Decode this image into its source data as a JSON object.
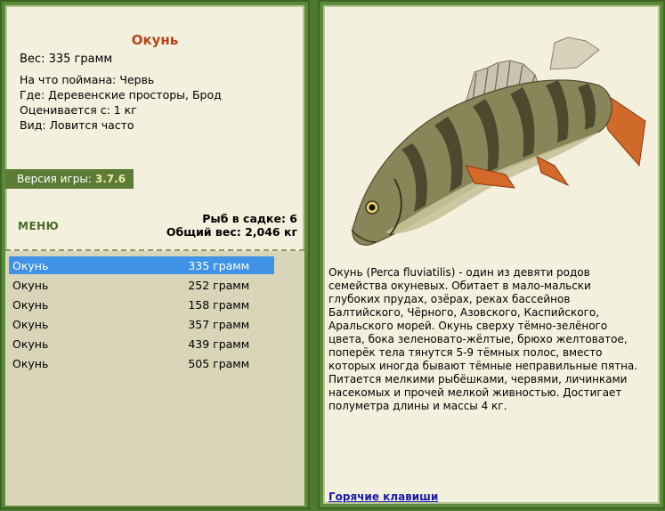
{
  "fish": {
    "title": "Окунь",
    "weight": "Вес: 335 грамм",
    "caught_on": "На что поймана: Червь",
    "location": "Где: Деревенские просторы, Брод",
    "rated_from": "Оценивается с: 1 кг",
    "view": "Вид: Ловится часто"
  },
  "version": {
    "label": "Версия игры:",
    "value": "3.7.6"
  },
  "menu": {
    "label": "МЕНЮ"
  },
  "stats": {
    "fish_count": "Рыб в садке: 6",
    "total_weight": "Общий вес: 2,046 кг"
  },
  "catch_list": [
    {
      "name": "Окунь",
      "weight": "335 грамм",
      "selected": true
    },
    {
      "name": "Окунь",
      "weight": "252 грамм",
      "selected": false
    },
    {
      "name": "Окунь",
      "weight": "158 грамм",
      "selected": false
    },
    {
      "name": "Окунь",
      "weight": "357 грамм",
      "selected": false
    },
    {
      "name": "Окунь",
      "weight": "439 грамм",
      "selected": false
    },
    {
      "name": "Окунь",
      "weight": "505 грамм",
      "selected": false
    }
  ],
  "description": "Окунь (Perca fluviatilis) - один из девяти родов семейства окуневых. Обитает в мало-мальски глубоких прудах, озёрах, реках бассейнов Балтийского, Чёрного, Азовского, Каспийского, Аральского морей. Окунь сверху тёмно-зелёного цвета, бока зеленовато-жёлтые, брюхо желтоватое, поперёк тела тянутся 5-9 тёмных полос, вместо которых иногда бывают тёмные неправильные пятна. Питается мелкими рыбёшками, червями, личинками насекомых и прочей мелкой живностью. Достигает полуметра длины и массы 4 кг.",
  "hotkeys": {
    "label": "Горячие клавиши"
  },
  "colors": {
    "background": "#4e7a30",
    "panel": "#f3f0dd",
    "title": "#b8421a",
    "selection": "#3f92e6",
    "link": "#1a1aa8"
  }
}
